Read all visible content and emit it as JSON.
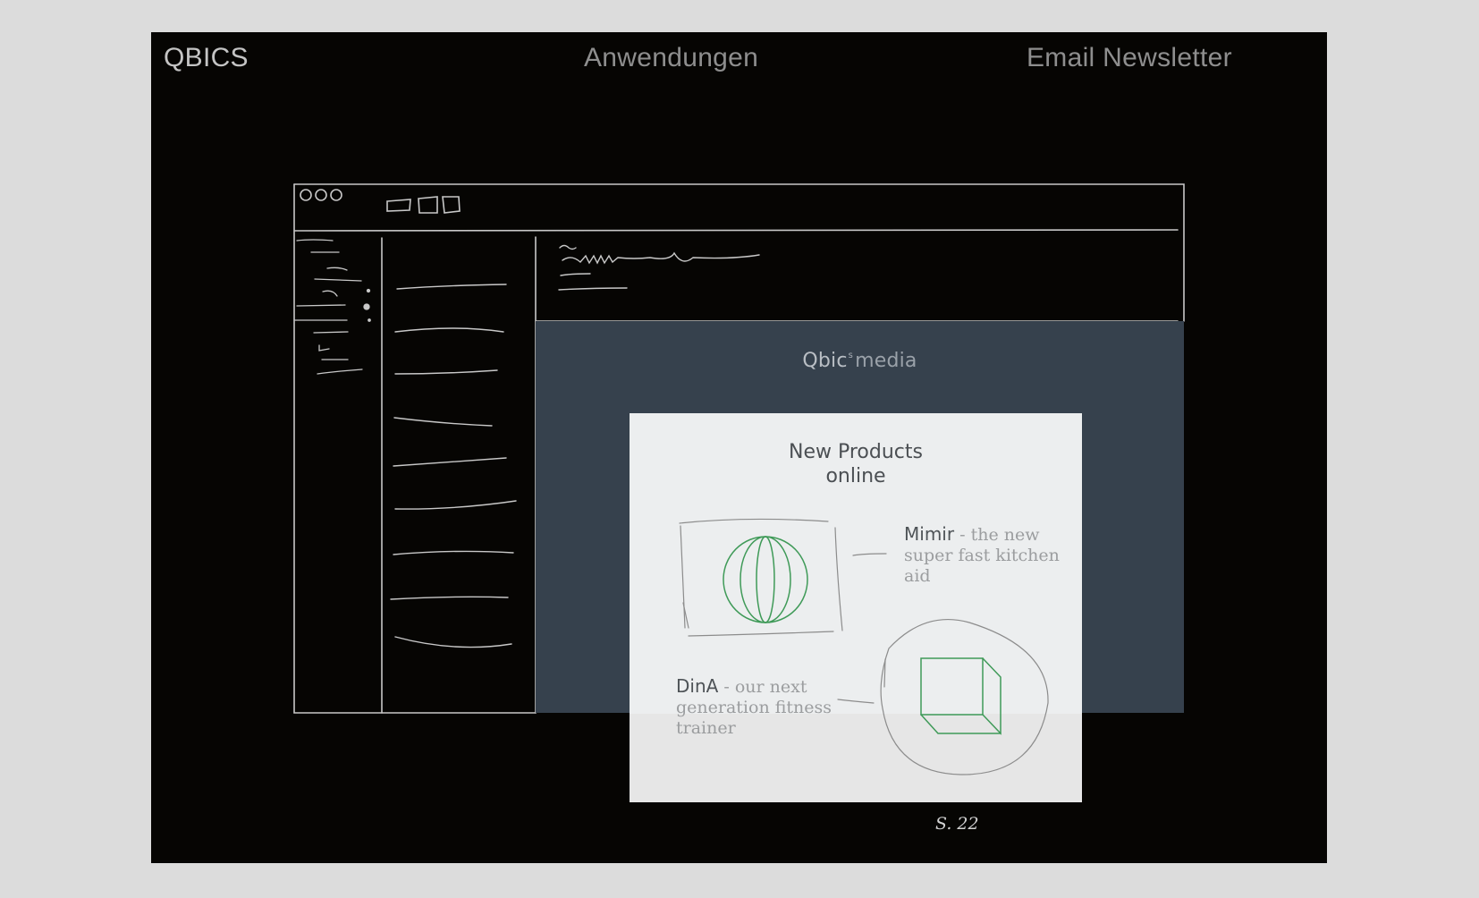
{
  "header": {
    "brand": "QBICS",
    "nav_applications": "Anwendungen",
    "nav_newsletter": "Email Newsletter"
  },
  "media_panel": {
    "logo_main": "Qbic",
    "logo_superscript": "s",
    "logo_suffix": "media"
  },
  "newsletter": {
    "title_line1": "New Products",
    "title_line2": "online",
    "products": [
      {
        "name": "Mimir",
        "description": " - the new super fast kitchen aid",
        "icon": "globe-sketch-icon"
      },
      {
        "name": "DinA",
        "description": " - our next generation fitness trainer",
        "icon": "cube-sketch-icon"
      }
    ]
  },
  "footer": {
    "page_number": "S. 22"
  },
  "colors": {
    "slide_background": "#060503",
    "media_panel": "#36414d",
    "card_background": "#eceeef",
    "sketch_lines": "#c8c8c8",
    "product_accent": "#3f9a58"
  }
}
